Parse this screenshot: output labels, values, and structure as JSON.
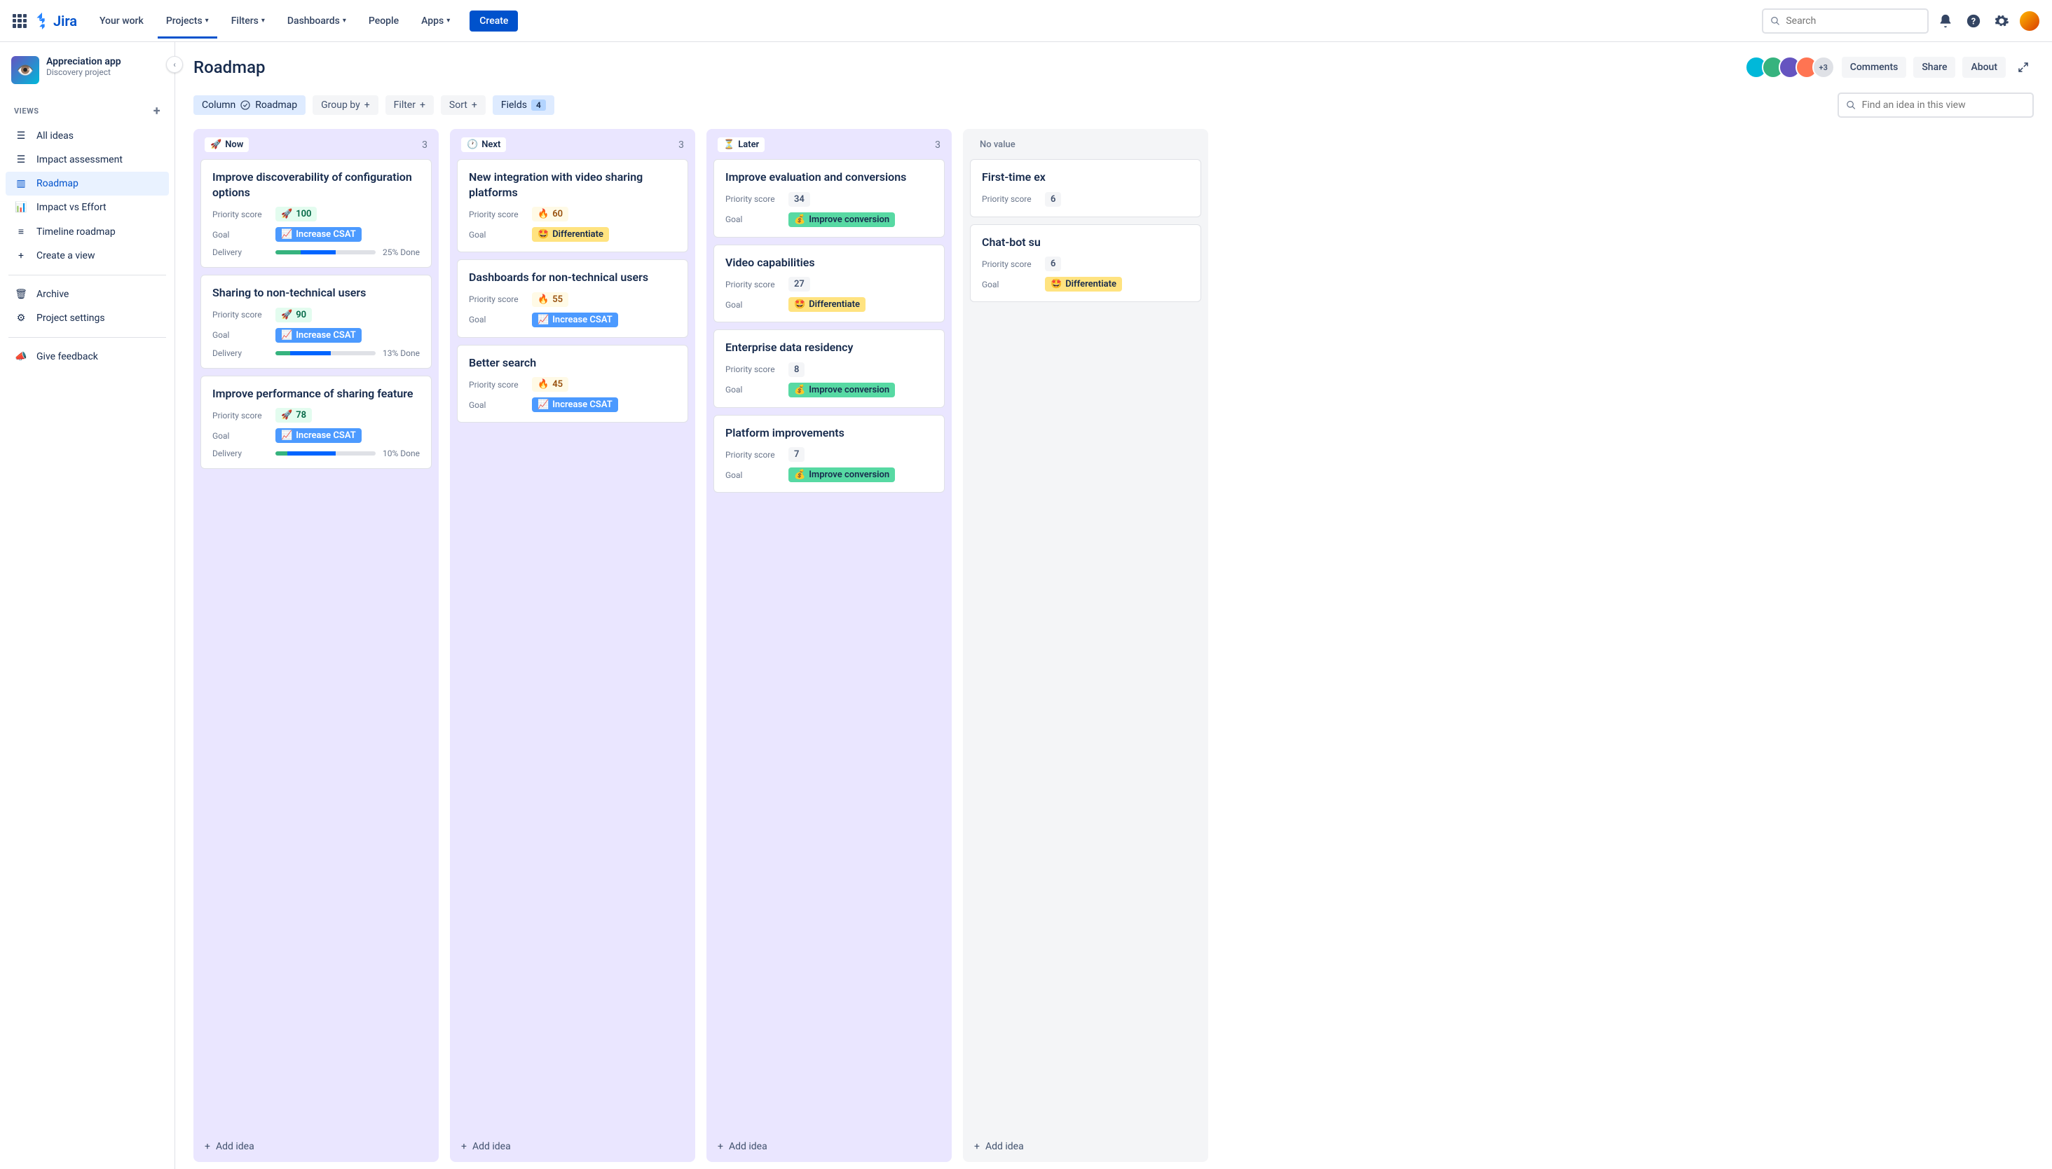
{
  "nav": {
    "logo": "Jira",
    "your_work": "Your work",
    "projects": "Projects",
    "filters": "Filters",
    "dashboards": "Dashboards",
    "people": "People",
    "apps": "Apps",
    "create": "Create",
    "search_placeholder": "Search"
  },
  "project": {
    "name": "Appreciation app",
    "type": "Discovery project"
  },
  "sidebar": {
    "views_label": "VIEWS",
    "items": [
      {
        "label": "All ideas"
      },
      {
        "label": "Impact assessment"
      },
      {
        "label": "Roadmap"
      },
      {
        "label": "Impact vs Effort"
      },
      {
        "label": "Timeline roadmap"
      },
      {
        "label": "Create a view"
      }
    ],
    "archive": "Archive",
    "settings": "Project settings",
    "feedback": "Give feedback"
  },
  "header": {
    "title": "Roadmap",
    "avatar_more": "+3",
    "comments": "Comments",
    "share": "Share",
    "about": "About"
  },
  "filters": {
    "column_label": "Column",
    "column_value": "Roadmap",
    "group_by": "Group by",
    "filter": "Filter",
    "sort": "Sort",
    "fields": "Fields",
    "fields_count": "4",
    "find_placeholder": "Find an idea in this view"
  },
  "field_labels": {
    "priority": "Priority score",
    "goal": "Goal",
    "delivery": "Delivery"
  },
  "goals": {
    "csat": "Increase CSAT",
    "diff": "Differentiate",
    "conv": "Improve conversion"
  },
  "add_idea": "Add idea",
  "columns": [
    {
      "key": "now",
      "emoji": "🚀",
      "label": "Now",
      "count": "3",
      "cards": [
        {
          "title": "Improve discoverability of configuration options",
          "score": "100",
          "score_emoji": "🚀",
          "score_cls": "score-high",
          "goal": "csat",
          "prog1": 25,
          "prog2": 35,
          "done": "25% Done"
        },
        {
          "title": "Sharing to non-technical users",
          "score": "90",
          "score_emoji": "🚀",
          "score_cls": "score-high",
          "goal": "csat",
          "prog1": 15,
          "prog2": 40,
          "done": "13% Done"
        },
        {
          "title": "Improve performance of sharing feature",
          "score": "78",
          "score_emoji": "🚀",
          "score_cls": "score-high",
          "goal": "csat",
          "prog1": 12,
          "prog2": 48,
          "done": "10% Done"
        }
      ]
    },
    {
      "key": "next",
      "emoji": "🕐",
      "label": "Next",
      "count": "3",
      "cards": [
        {
          "title": "New integration with video sharing platforms",
          "score": "60",
          "score_emoji": "🔥",
          "score_cls": "score-med",
          "goal": "diff"
        },
        {
          "title": "Dashboards for non-technical users",
          "score": "55",
          "score_emoji": "🔥",
          "score_cls": "score-med",
          "goal": "csat"
        },
        {
          "title": "Better search",
          "score": "45",
          "score_emoji": "🔥",
          "score_cls": "score-med",
          "goal": "csat"
        }
      ]
    },
    {
      "key": "later",
      "emoji": "⏳",
      "label": "Later",
      "count": "3",
      "cards": [
        {
          "title": "Improve evaluation and conversions",
          "score": "34",
          "score_emoji": "",
          "score_cls": "score-low",
          "goal": "conv",
          "goal_emoji": "💰"
        },
        {
          "title": "Video capabilities",
          "score": "27",
          "score_emoji": "",
          "score_cls": "score-low",
          "goal": "diff",
          "goal_emoji": "🤩"
        },
        {
          "title": "Enterprise data residency",
          "score": "8",
          "score_emoji": "",
          "score_cls": "score-low",
          "goal": "conv",
          "goal_emoji": "💰"
        },
        {
          "title": "Platform improvements",
          "score": "7",
          "score_emoji": "",
          "score_cls": "score-low",
          "goal": "conv",
          "goal_emoji": "💰"
        }
      ]
    },
    {
      "key": "noval",
      "emoji": "",
      "label": "No value",
      "count": "",
      "cards": [
        {
          "title": "First-time ex",
          "score": "6",
          "score_emoji": "",
          "score_cls": "score-low"
        },
        {
          "title": "Chat-bot su",
          "score": "6",
          "score_emoji": "",
          "score_cls": "score-low",
          "goal": "diff",
          "goal_emoji": "🤩"
        }
      ]
    }
  ]
}
